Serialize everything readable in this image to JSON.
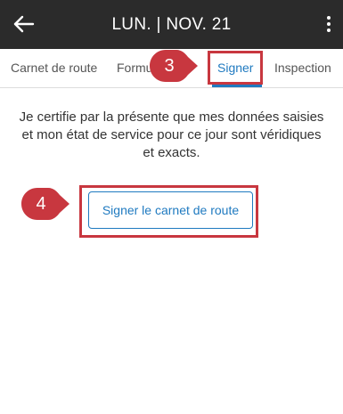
{
  "appbar": {
    "title": "LUN. | NOV. 21",
    "back_icon": "arrow-left-icon",
    "more_icon": "more-vertical-icon"
  },
  "tabs": [
    {
      "label": "Carnet de route",
      "active": false
    },
    {
      "label": "Formu",
      "active": false
    },
    {
      "label": "Signer",
      "active": true
    },
    {
      "label": "Inspection",
      "active": false
    }
  ],
  "callouts": [
    {
      "number": "3"
    },
    {
      "number": "4"
    }
  ],
  "main": {
    "certification_text": "Je certifie par la présente que mes données saisies et mon état de service pour ce jour sont véridiques et exacts.",
    "sign_button_label": "Signer le carnet de route"
  },
  "colors": {
    "appbar_bg": "#2b2b2b",
    "accent": "#1f7ac0",
    "highlight": "#c8373f"
  }
}
